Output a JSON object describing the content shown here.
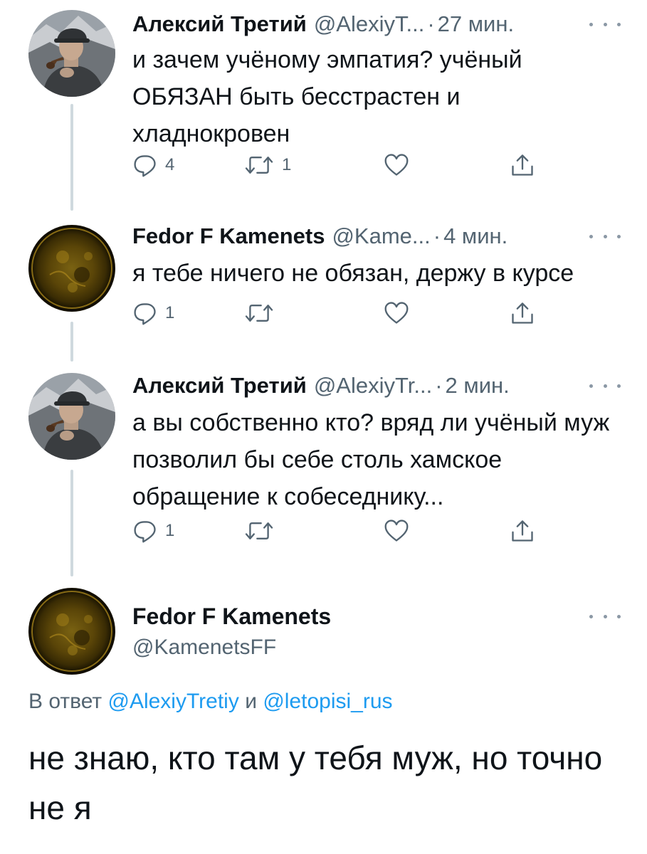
{
  "thread": [
    {
      "author_name": "Алексий Третий",
      "author_handle": "@AlexiyT...",
      "separator": "·",
      "time": "27 мин.",
      "text": "и зачем учёному эмпатия? учёный ОБЯЗАН быть бесстрастен и хладнокровен",
      "replies": "4",
      "retweets": "1",
      "likes": "",
      "avatar_icon": "man-in-cap-smoking-pipe-photo"
    },
    {
      "author_name": "Fedor F Kamenets",
      "author_handle": "@Kame...",
      "separator": "·",
      "time": "4 мин.",
      "text": "я тебе ничего не обязан, держу в курсе",
      "replies": "1",
      "retweets": "",
      "likes": "",
      "avatar_icon": "dark-golden-sun-photo"
    },
    {
      "author_name": "Алексий Третий",
      "author_handle": "@AlexiyTr...",
      "separator": "·",
      "time": "2 мин.",
      "text": "а вы собственно кто? вряд ли учёный муж позволил бы себе столь хамское обращение к собеседнику...",
      "replies": "1",
      "retweets": "",
      "likes": "",
      "avatar_icon": "man-in-cap-smoking-pipe-photo"
    }
  ],
  "main_tweet": {
    "author_name": "Fedor F Kamenets",
    "author_handle": "@KamenetsFF",
    "reply_prefix": "В ответ",
    "reply_user_1": "@AlexiyTretiy",
    "reply_and": "и",
    "reply_user_2": "@letopisi_rus",
    "text": "не знаю, кто там у тебя муж, но точно не я",
    "avatar_icon": "dark-golden-sun-photo"
  },
  "icons": {
    "reply": "speech-bubble-icon",
    "retweet": "retweet-arrows-icon",
    "like": "heart-icon",
    "share": "share-upload-icon",
    "more": "three-dots-icon"
  },
  "colors": {
    "text_primary": "#0f1419",
    "text_secondary": "#536471",
    "link": "#1d9bf0",
    "thread_line": "#cfd9de"
  }
}
